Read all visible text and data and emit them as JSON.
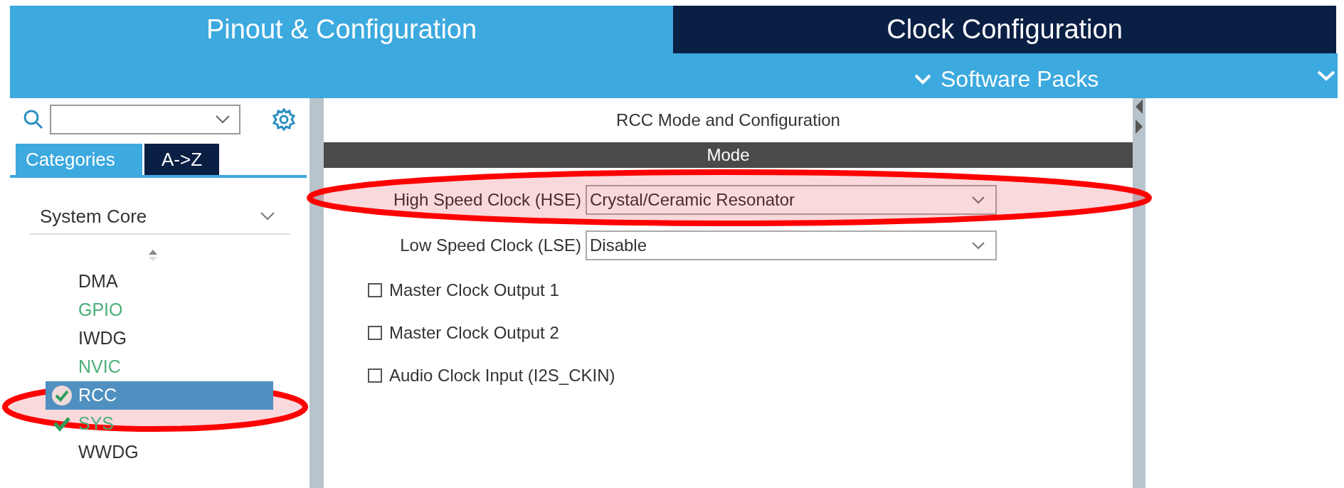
{
  "top_tabs": [
    {
      "label": "Pinout & Configuration",
      "selected": true
    },
    {
      "label": "Clock Configuration",
      "selected": false
    }
  ],
  "menu_bar": {
    "label": "Software Packs"
  },
  "sidebar": {
    "tabs": [
      {
        "label": "Categories",
        "selected": true
      },
      {
        "label": "A->Z",
        "selected": false
      }
    ],
    "category": "System Core",
    "items": [
      {
        "label": "DMA",
        "configured": false,
        "checked": false,
        "selected": false
      },
      {
        "label": "GPIO",
        "configured": true,
        "checked": false,
        "selected": false
      },
      {
        "label": "IWDG",
        "configured": false,
        "checked": false,
        "selected": false
      },
      {
        "label": "NVIC",
        "configured": true,
        "checked": false,
        "selected": false
      },
      {
        "label": "RCC",
        "configured": true,
        "checked": true,
        "selected": true
      },
      {
        "label": "SYS",
        "configured": true,
        "checked": true,
        "selected": false
      },
      {
        "label": "WWDG",
        "configured": false,
        "checked": false,
        "selected": false
      }
    ]
  },
  "panel": {
    "title": "RCC Mode and Configuration",
    "section": "Mode",
    "fields": [
      {
        "kind": "select",
        "label": "High Speed Clock (HSE)",
        "value": "Crystal/Ceramic Resonator"
      },
      {
        "kind": "select",
        "label": "Low Speed Clock (LSE)",
        "value": "Disable"
      },
      {
        "kind": "checkbox",
        "label": "Master Clock Output 1",
        "checked": false
      },
      {
        "kind": "checkbox",
        "label": "Master Clock Output 2",
        "checked": false
      },
      {
        "kind": "checkbox",
        "label": "Audio Clock Input (I2S_CKIN)",
        "checked": false
      }
    ]
  }
}
